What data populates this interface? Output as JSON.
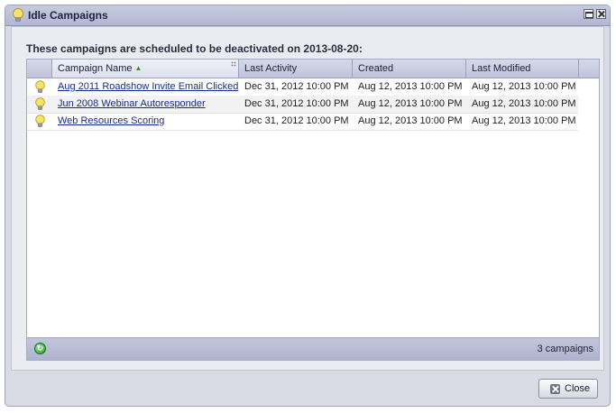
{
  "window": {
    "title": "Idle Campaigns",
    "icon": "lightbulb-icon"
  },
  "heading": "These campaigns are scheduled to be deactivated on 2013-08-20:",
  "grid": {
    "columns": [
      "Campaign Name",
      "Last Activity",
      "Created",
      "Last Modified"
    ],
    "sorted_column": "Campaign Name",
    "sort_direction": "ascending",
    "rows": [
      {
        "icon": "lightbulb-icon",
        "name": "Aug 2011 Roadshow Invite Email Clicked",
        "last_activity": "Dec 31, 2012 10:00 PM",
        "created": "Aug 12, 2013 10:00 PM",
        "last_modified": "Aug 12, 2013 10:00 PM"
      },
      {
        "icon": "lightbulb-icon",
        "name": "Jun 2008 Webinar Autoresponder",
        "last_activity": "Dec 31, 2012 10:00 PM",
        "created": "Aug 12, 2013 10:00 PM",
        "last_modified": "Aug 12, 2013 10:00 PM"
      },
      {
        "icon": "lightbulb-icon",
        "name": "Web Resources Scoring",
        "last_activity": "Dec 31, 2012 10:00 PM",
        "created": "Aug 12, 2013 10:00 PM",
        "last_modified": "Aug 12, 2013 10:00 PM"
      }
    ],
    "footer_count": "3 campaigns",
    "refresh_icon": "refresh-icon"
  },
  "buttons": {
    "close_label": "Close"
  }
}
